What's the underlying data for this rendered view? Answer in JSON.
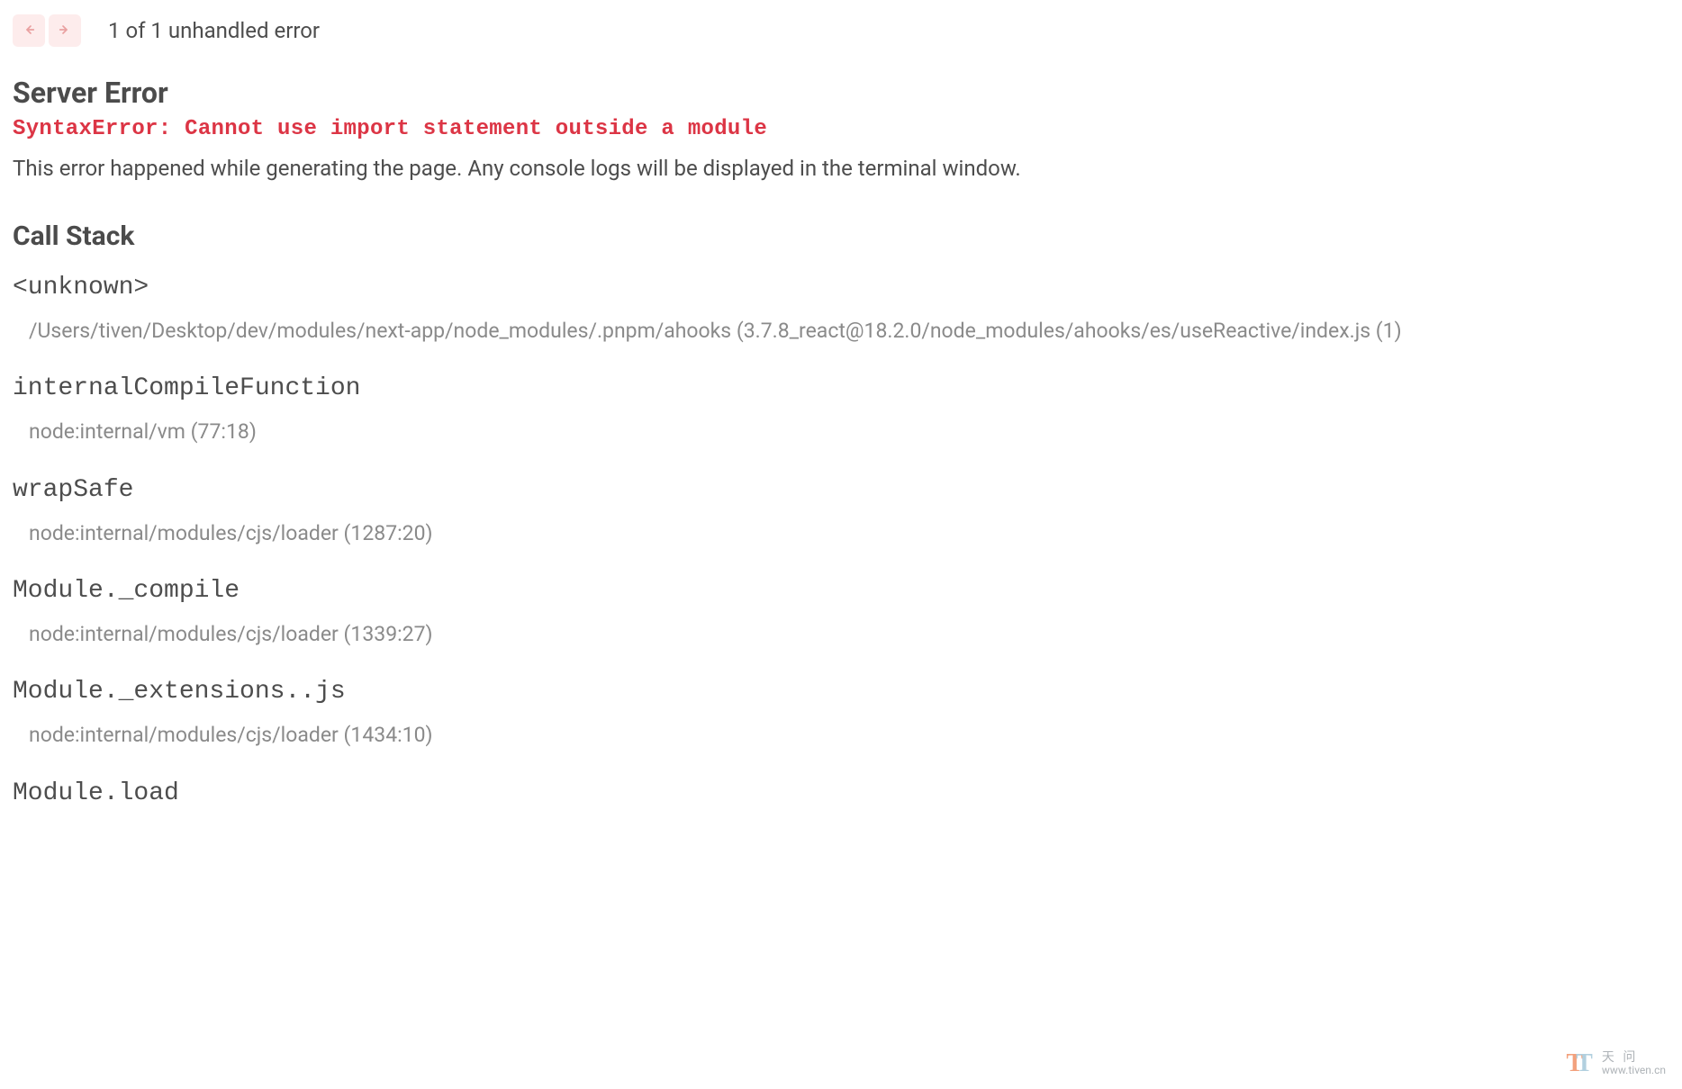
{
  "nav": {
    "counter": "1 of 1 unhandled error"
  },
  "error": {
    "heading": "Server Error",
    "title": "SyntaxError: Cannot use import statement outside a module",
    "description": "This error happened while generating the page. Any console logs will be displayed in the terminal window."
  },
  "callstack": {
    "heading": "Call Stack",
    "frames": [
      {
        "method": "<unknown>",
        "location": "/Users/tiven/Desktop/dev/modules/next-app/node_modules/.pnpm/ahooks (3.7.8_react@18.2.0/node_modules/ahooks/es/useReactive/index.js (1)"
      },
      {
        "method": "internalCompileFunction",
        "location": "node:internal/vm (77:18)"
      },
      {
        "method": "wrapSafe",
        "location": "node:internal/modules/cjs/loader (1287:20)"
      },
      {
        "method": "Module._compile",
        "location": "node:internal/modules/cjs/loader (1339:27)"
      },
      {
        "method": "Module._extensions..js",
        "location": "node:internal/modules/cjs/loader (1434:10)"
      },
      {
        "method": "Module.load",
        "location": ""
      }
    ]
  },
  "watermark": {
    "title": "天 问",
    "url": "www.tiven.cn"
  }
}
